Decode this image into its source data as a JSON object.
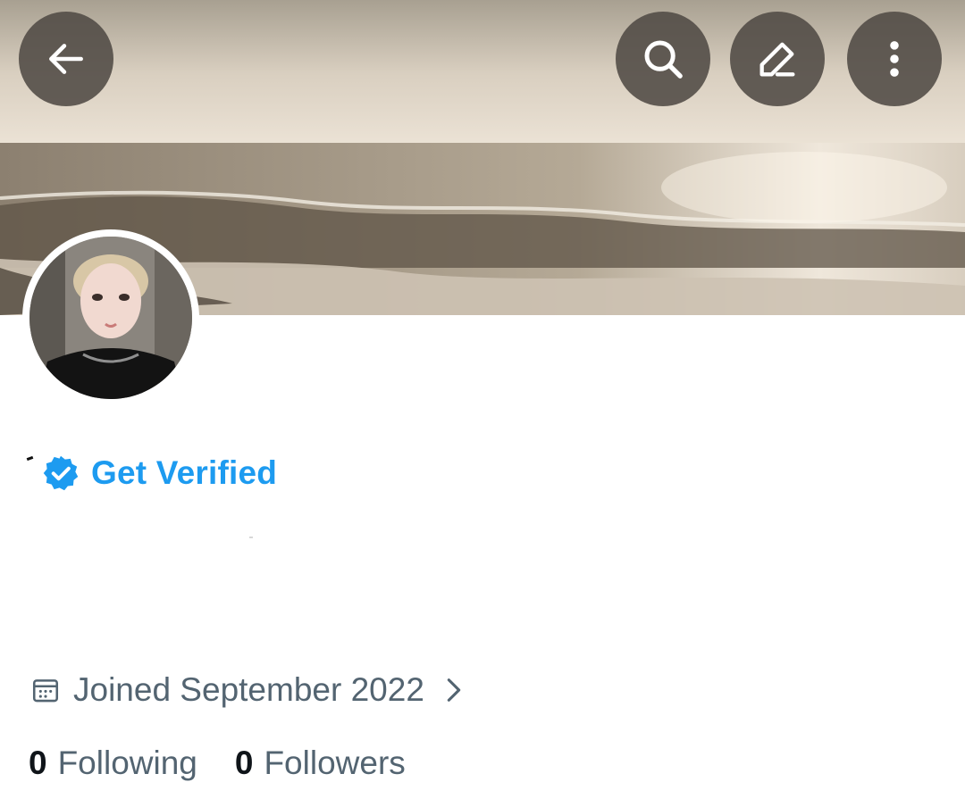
{
  "header": {
    "back_icon": "arrow-left-icon",
    "search_icon": "search-icon",
    "edit_icon": "pencil-icon",
    "more_icon": "more-vertical-icon",
    "banner_description": "ocean-waves-sepia"
  },
  "profile": {
    "verify_label": "Get Verified",
    "verify_color": "#1d9bf0",
    "joined_text": "Joined September 2022",
    "following_count": "0",
    "following_label": "Following",
    "followers_count": "0",
    "followers_label": "Followers"
  },
  "colors": {
    "accent": "#1d9bf0",
    "secondary_text": "#536471",
    "primary_text": "#0f1419",
    "button_overlay": "#504a44"
  }
}
